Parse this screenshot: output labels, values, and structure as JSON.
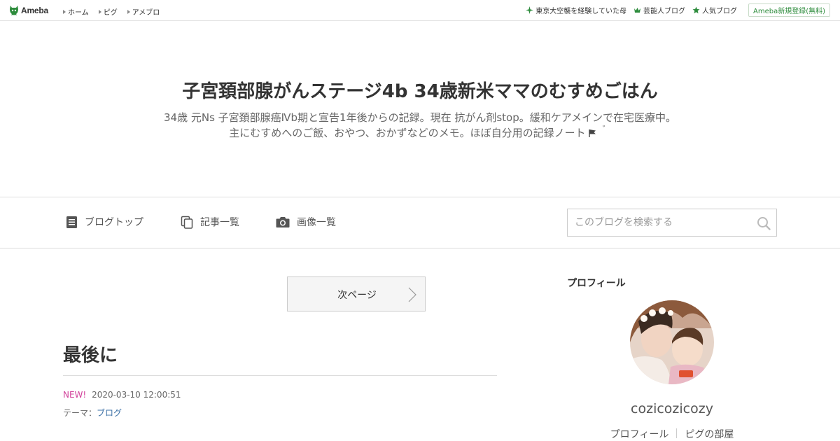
{
  "header": {
    "logo_text": "Ameba",
    "nav": [
      {
        "label": "ホーム"
      },
      {
        "label": "ピグ"
      },
      {
        "label": "アメブロ"
      }
    ],
    "links": [
      {
        "label": "東京大空襲を経験していた母",
        "icon": "sparkle-icon"
      },
      {
        "label": "芸能人ブログ",
        "icon": "crown-icon"
      },
      {
        "label": "人気ブログ",
        "icon": "star-icon"
      }
    ],
    "register_label": "Ameba新規登録(無料)"
  },
  "blog": {
    "title": "子宮頚部腺がんステージ4b 34歳新米ママのむすめごはん",
    "description_line1": "34歳 元Ns 子宮頚部腺癌Ⅳb期と宣告1年後からの記録。現在 抗がん剤stop。緩和ケアメインで在宅医療中。",
    "description_line2": "主にむすめへのご飯、おやつ、おかずなどのメモ。ほぼ自分用の記録ノート",
    "description_suffix": "゛"
  },
  "navbar": {
    "items": [
      {
        "label": "ブログトップ",
        "icon": "document-icon"
      },
      {
        "label": "記事一覧",
        "icon": "copy-icon"
      },
      {
        "label": "画像一覧",
        "icon": "camera-icon"
      }
    ],
    "search_placeholder": "このブログを検索する"
  },
  "main": {
    "next_label": "次ページ",
    "entry_title": "最後に",
    "new_badge": "NEW!",
    "date": "2020-03-10 12:00:51",
    "theme_label": "テーマ：",
    "theme_value": "ブログ"
  },
  "sidebar": {
    "heading": "プロフィール",
    "name": "cozicozicozy",
    "links": [
      {
        "label": "プロフィール"
      },
      {
        "label": "ピグの部屋"
      }
    ]
  },
  "colors": {
    "brand_green": "#2d8c3c",
    "new_pink": "#d2449c",
    "link_blue": "#3a6fa5"
  }
}
